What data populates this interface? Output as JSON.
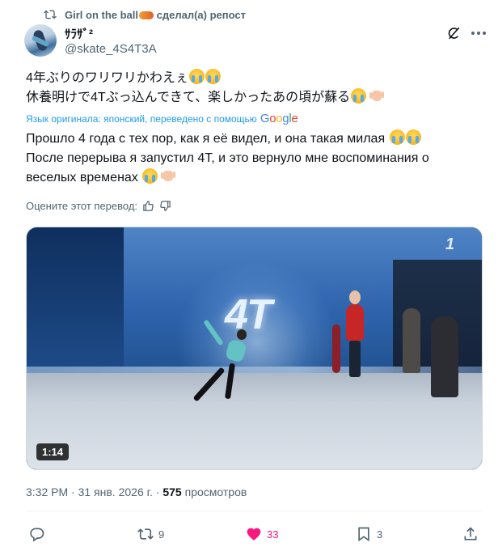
{
  "repost": {
    "user": "Girl on the ball",
    "label": "сделал(а) репост"
  },
  "author": {
    "display_name": "ｻﾗｻﾞ²",
    "handle": "@skate_4S4T3A"
  },
  "tweet": {
    "line1": "4年ぶりのワリワリかわえぇ",
    "line2": "休養明けで4Tぶっ込んできて、楽しかったあの頃が蘇る"
  },
  "translation": {
    "note": "Язык оригинала: японский, переведено с помощью",
    "provider": "Google",
    "line1": "Прошло 4 года с тех пор, как я её видел, и она такая милая",
    "line2": "После перерыва я запустил 4T, и это вернуло мне воспоминания о",
    "line3": "веселых временах",
    "rate_label": "Оцените этот перевод:"
  },
  "media": {
    "duration": "1:14",
    "overlay_text": "4T"
  },
  "meta": {
    "time": "3:32 PM",
    "date": "31 янв. 2026 г.",
    "views": "575",
    "views_label": "просмотров"
  },
  "actions": {
    "reply_count": "",
    "retweet_count": "9",
    "like_count": "33",
    "bookmark_count": "3"
  },
  "colors": {
    "accent": "#1d9bf0",
    "like": "#f91880",
    "secondary_text": "#536471",
    "text": "#0f1419"
  },
  "icons": [
    "retweet-icon",
    "grok-icon",
    "more-icon",
    "thumbs-up-icon",
    "thumbs-down-icon",
    "reply-icon",
    "heart-icon",
    "bookmark-icon",
    "share-icon"
  ]
}
